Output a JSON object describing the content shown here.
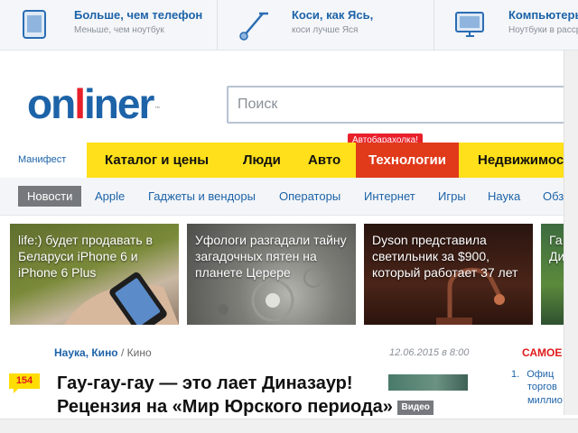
{
  "promo": [
    {
      "title": "Больше, чем телефон",
      "subtitle": "Меньше, чем ноутбук",
      "icon": "tablet-icon"
    },
    {
      "title": "Коси, как Ясь,",
      "subtitle": "коси лучше Яся",
      "icon": "trimmer-icon"
    },
    {
      "title": "Компьютеры",
      "subtitle": "Ноутбуки в рассрочку",
      "icon": "monitor-icon"
    }
  ],
  "logo": {
    "pre": "on",
    "accent": "l",
    "post": "iner",
    "tm": "™"
  },
  "search": {
    "placeholder": "Поиск",
    "value": ""
  },
  "manifest": "Манифест",
  "mainnav": [
    {
      "label": "Каталог и цены"
    },
    {
      "label": "Люди"
    },
    {
      "label": "Авто"
    },
    {
      "label": "Технологии"
    },
    {
      "label": "Недвижимость"
    }
  ],
  "avto_badge": "Автобарахолка!",
  "subnav": [
    {
      "label": "Новости"
    },
    {
      "label": "Apple"
    },
    {
      "label": "Гаджеты и вендоры"
    },
    {
      "label": "Операторы"
    },
    {
      "label": "Интернет"
    },
    {
      "label": "Игры"
    },
    {
      "label": "Наука"
    },
    {
      "label": "Обзоры"
    }
  ],
  "tiles": [
    {
      "title": "life:) будет продавать в Беларуси iPhone 6 и iPhone 6 Plus"
    },
    {
      "title": "Уфологи разгадали тайну загадочных пятен на планете Церере"
    },
    {
      "title": "Dyson представила светильник за $900, который работает 37 лет"
    },
    {
      "title": "Га... Ди..."
    }
  ],
  "article": {
    "cat_main": "Наука, Кино",
    "cat_sep": " / ",
    "cat_sub": "Кино",
    "date": "12.06.2015 в 8:00",
    "comments": "154",
    "headline": "Гау-гау-гау — это лает Диназаур! Рецензия на «Мир Юрского периода»",
    "video_badge": "Видео"
  },
  "right": {
    "title": "САМОЕ",
    "item1_num": "1.",
    "item1_line1": "Офиц",
    "item1_line2": "торгов",
    "item1_line3": "миллио"
  },
  "colors": {
    "brand_blue": "#1d63a8",
    "brand_red": "#e8202a",
    "nav_yellow": "#ffe01a",
    "nav_active": "#e03a1a"
  }
}
